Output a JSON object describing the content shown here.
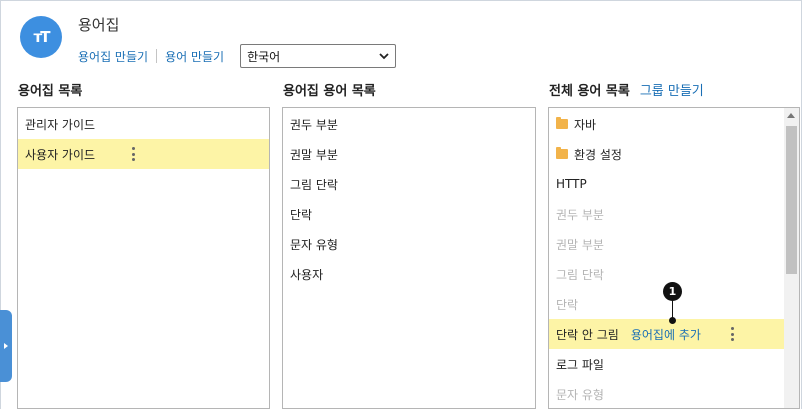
{
  "app": {
    "icon_text": "ᴛT",
    "title": "용어집"
  },
  "toolbar": {
    "create_glossary": "용어집 만들기",
    "create_term": "용어 만들기",
    "language_selected": "한국어"
  },
  "columns": {
    "glossary_list": {
      "title": "용어집 목록"
    },
    "glossary_terms": {
      "title": "용어집 용어 목록"
    },
    "all_terms": {
      "title": "전체 용어 목록",
      "create_group": "그룹 만들기"
    }
  },
  "glossaries": [
    {
      "label": "관리자 가이드",
      "selected": false
    },
    {
      "label": "사용자 가이드",
      "selected": true
    }
  ],
  "glossary_terms": [
    {
      "label": "권두 부분"
    },
    {
      "label": "권말 부분"
    },
    {
      "label": "그림 단락"
    },
    {
      "label": "단락"
    },
    {
      "label": "문자 유형"
    },
    {
      "label": "사용자"
    }
  ],
  "all_terms": [
    {
      "label": "자바",
      "type": "folder",
      "disabled": false
    },
    {
      "label": "환경 설정",
      "type": "folder",
      "disabled": false
    },
    {
      "label": "HTTP",
      "type": "term",
      "disabled": false
    },
    {
      "label": "권두 부분",
      "type": "term",
      "disabled": true
    },
    {
      "label": "권말 부분",
      "type": "term",
      "disabled": true
    },
    {
      "label": "그림 단락",
      "type": "term",
      "disabled": true
    },
    {
      "label": "단락",
      "type": "term",
      "disabled": true
    },
    {
      "label": "단락 안 그림",
      "type": "term",
      "disabled": false,
      "selected": true,
      "action": "용어집에 추가"
    },
    {
      "label": "로그 파일",
      "type": "term",
      "disabled": false
    },
    {
      "label": "문자 유형",
      "type": "term",
      "disabled": true
    }
  ],
  "callout": {
    "number": "1"
  },
  "colors": {
    "accent": "#3d8fe0",
    "link": "#1a6fb5",
    "selected_row": "#fdf4a6",
    "disabled_text": "#b4b4b4"
  }
}
